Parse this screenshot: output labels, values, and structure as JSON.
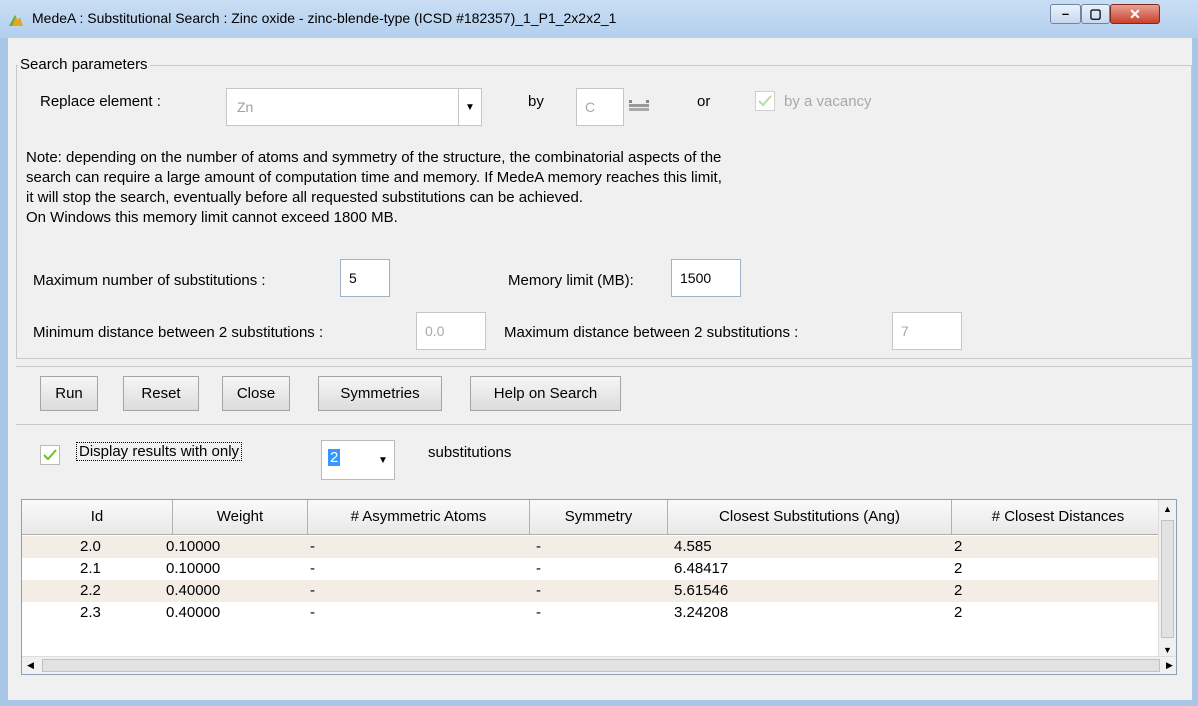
{
  "window": {
    "title": "MedeA : Substitutional Search : Zinc oxide - zinc-blende-type (ICSD #182357)_1_P1_2x2x2_1",
    "min_glyph": "–",
    "max_glyph": "▢",
    "close_glyph": "✕"
  },
  "search": {
    "legend": "Search parameters",
    "replace_label": "Replace element :",
    "replace_value": "Zn",
    "by_label": "by",
    "by_value": "C",
    "or_label": "or",
    "vacancy_label": "by a vacancy",
    "note": "Note: depending on the number of atoms and symmetry of the structure, the combinatorial aspects of the search can require a large amount of computation time and  memory. If MedeA memory reaches this limit, it will stop the search, eventually before all requested substitutions can be achieved. On Windows this memory limit cannot exceed 1800 MB.",
    "note_lines": [
      "Note: depending on the number of atoms and symmetry of the structure, the combinatorial aspects of the",
      "search can require a large amount of computation time and  memory. If MedeA memory reaches this limit,",
      "it will stop the search, eventually before all requested substitutions can be achieved.",
      "On Windows this memory limit cannot exceed 1800 MB."
    ],
    "max_subs_label": "Maximum number of substitutions :",
    "max_subs_value": "5",
    "memory_label": "Memory limit (MB):",
    "memory_value": "1500",
    "min_dist_label": "Minimum distance between 2 substitutions :",
    "min_dist_value": "0.0",
    "max_dist_label": "Maximum distance between 2 substitutions :",
    "max_dist_value": "7"
  },
  "buttons": {
    "run": "Run",
    "reset": "Reset",
    "close": "Close",
    "symmetries": "Symmetries",
    "help": "Help on Search"
  },
  "filter": {
    "label": "Display results with only",
    "value": "2",
    "suffix": "substitutions"
  },
  "table": {
    "headers": [
      "Id",
      "Weight",
      "# Asymmetric Atoms",
      "Symmetry",
      "Closest Substitutions (Ang)",
      "# Closest Distances"
    ],
    "rows": [
      [
        "2.0",
        "0.10000",
        "-",
        "-",
        "4.585",
        "2"
      ],
      [
        "2.1",
        "0.10000",
        "-",
        "-",
        "6.48417",
        "2"
      ],
      [
        "2.2",
        "0.40000",
        "-",
        "-",
        "5.61546",
        "2"
      ],
      [
        "2.3",
        "0.40000",
        "-",
        "-",
        "3.24208",
        "2"
      ]
    ]
  },
  "colors": {
    "row_alt": "#f3ede6",
    "title_bar": "#b9d1ec",
    "check": "#6fbf2a"
  }
}
